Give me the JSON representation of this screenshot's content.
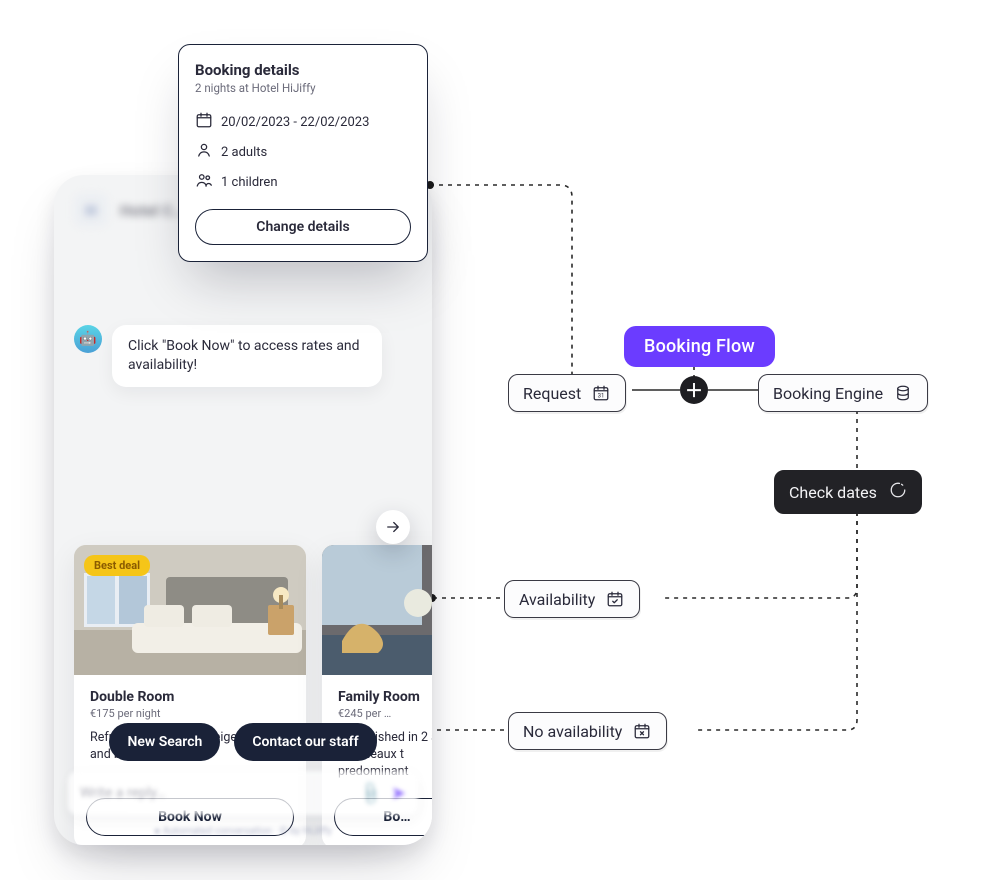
{
  "phone": {
    "app_title": "Hotel C…",
    "bot_message": "Click \"Book Now\" to access rates and availability!",
    "reply_placeholder": "Write a reply…",
    "footer": "● Automated conversation · © by HiJiffy"
  },
  "booking_details": {
    "title": "Booking details",
    "subtitle": "2 nights at Hotel HiJiffy",
    "dates": "20/02/2023 - 22/02/2023",
    "adults": "2 adults",
    "children": "1 children",
    "change_btn": "Change details"
  },
  "cards": [
    {
      "badge": "Best deal",
      "name": "Double Room",
      "price": "€175 per night",
      "desc": "Refurbished in 2017, beige, green and bourdeaux tones.",
      "cta": "Book Now"
    },
    {
      "badge": "",
      "name": "Family Room",
      "price": "€245 per …",
      "desc": "Refurbished in 2  and bourdeaux t  predominant",
      "cta": "Bo…"
    }
  ],
  "pills": {
    "new_search": "New Search",
    "contact": "Contact our staff"
  },
  "flow": {
    "title": "Booking Flow",
    "request": "Request",
    "booking_engine": "Booking Engine",
    "check_dates": "Check dates",
    "availability": "Availability",
    "no_availability": "No availability"
  }
}
